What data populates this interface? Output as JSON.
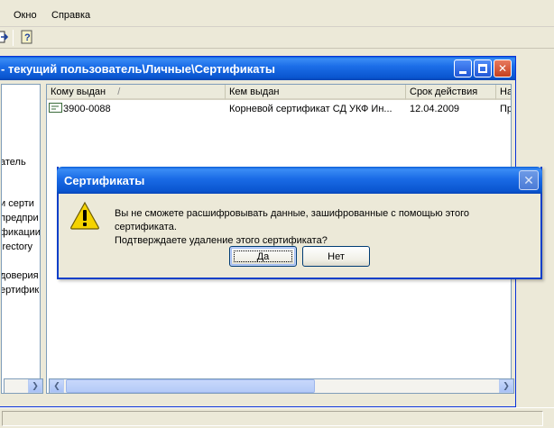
{
  "menu": {
    "items": [
      "Окно",
      "Справка"
    ]
  },
  "child_window": {
    "title": "- текущий пользователь\\Личные\\Сертификаты",
    "tree_items": [
      "атель",
      "и серти",
      "предпри",
      "фикации",
      "irectory",
      "доверия",
      "ертифик"
    ],
    "columns": [
      "Кому выдан",
      "Кем выдан",
      "Срок действия",
      "На"
    ],
    "rows": [
      {
        "issued_to": "3900-0088",
        "issued_by": "Корневой сертификат СД УКФ Ин...",
        "expires": "12.04.2009",
        "purpose": "Пр"
      }
    ],
    "sort_indicator": "/"
  },
  "dialog": {
    "title": "Сертификаты",
    "message_line1": "Вы не сможете расшифровывать данные, зашифрованные с помощью этого сертификата.",
    "message_line2": "Подтверждаете удаление этого сертификата?",
    "yes_label": "Да",
    "no_label": "Нет",
    "icon": "warning-icon"
  },
  "colors": {
    "titlebar": "#0a56d0",
    "background": "#ece9d8",
    "border": "#7f9db9"
  }
}
